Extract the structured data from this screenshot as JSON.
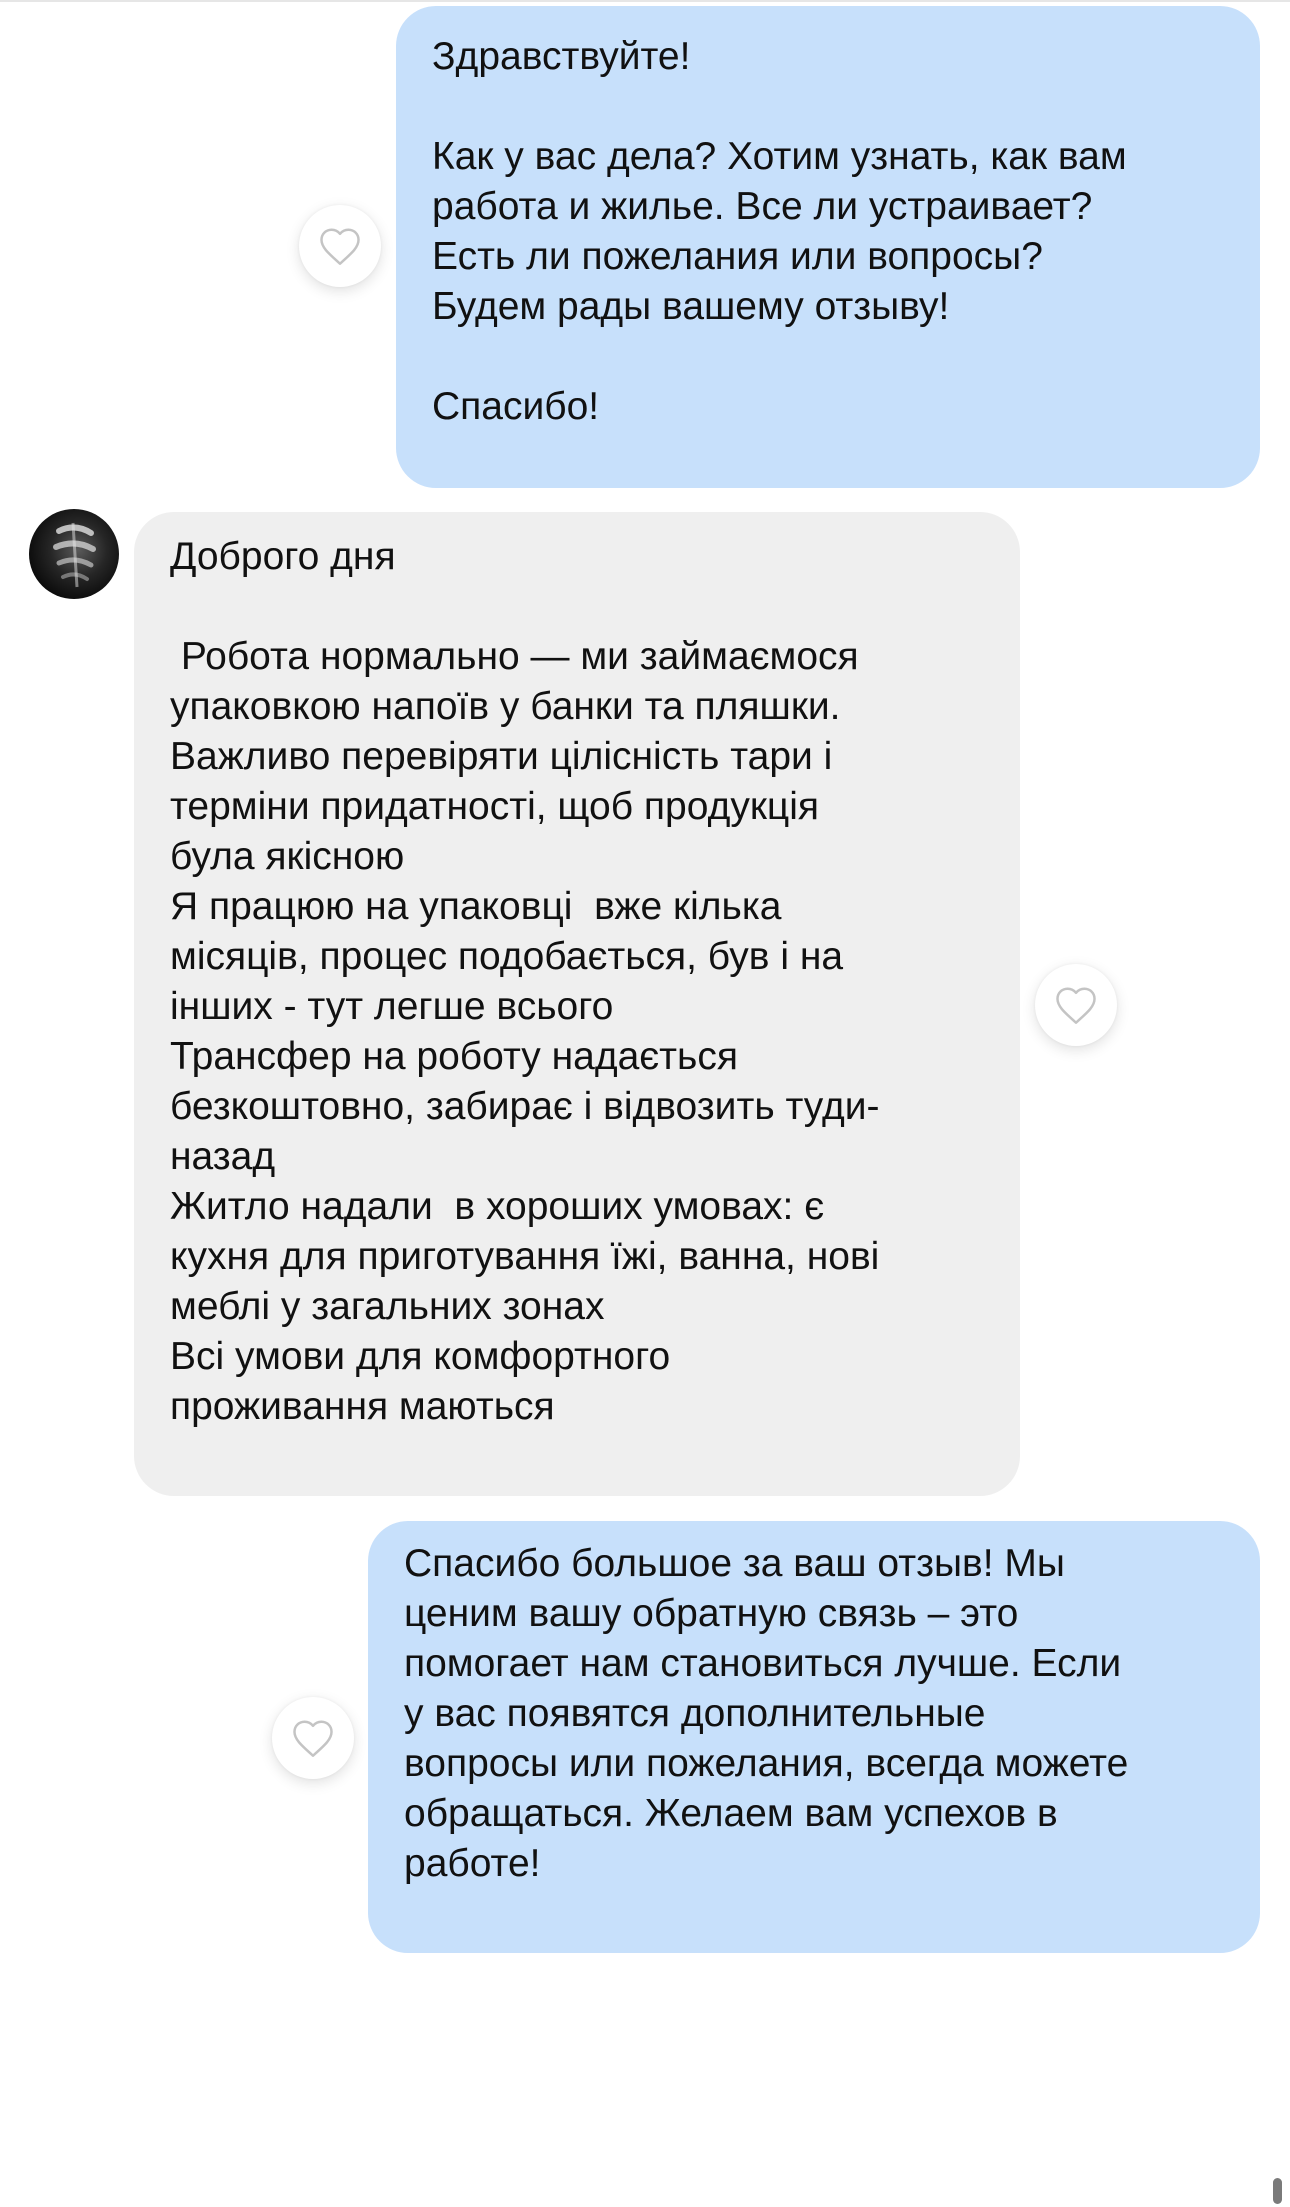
{
  "chat": {
    "messages": [
      {
        "direction": "outgoing",
        "text": "Здравствуйте!\n\nКак у вас дела? Хотим узнать, как вам\nработа и жилье. Все ли устраивает?\nЕсть ли пожелания или вопросы?\nБудем рады вашему отзыву!\n\nСпасибо!",
        "reaction_icon": "heart-outline-icon"
      },
      {
        "direction": "incoming",
        "sender_avatar": "avatar",
        "text": "Доброго дня\n\n Робота нормально — ми займаємося\nупаковкою напоїв у банки та пляшки.\nВажливо перевіряти цілісність тари і\nтерміни придатності, щоб продукція\nбула якісною\nЯ працюю на упаковці  вже кілька\nмісяців, процес подобається, був і на\nінших - тут легше всього\nТрансфер на роботу надається\nбезкоштовно, забирає і відвозить туди-\nназад\nЖитло надали  в хороших умовах: є\nкухня для приготування їжі, ванна, нові\nмеблі у загальних зонах\nВсі умови для комфортного\nпроживання маються",
        "reaction_icon": "heart-outline-icon"
      },
      {
        "direction": "outgoing",
        "text": "Спасибо большое за ваш отзыв! Мы\nценим вашу обратную связь – это\nпомогает нам становиться лучше. Если\nу вас появятся дополнительные\nвопросы или пожелания, всегда можете\nобращаться. Желаем вам успехов в\nработе!",
        "reaction_icon": "heart-outline-icon"
      }
    ]
  },
  "colors": {
    "outgoing_bubble": "#c7e0fb",
    "incoming_bubble": "#efefef",
    "heart_stroke": "#c4c4c4"
  }
}
